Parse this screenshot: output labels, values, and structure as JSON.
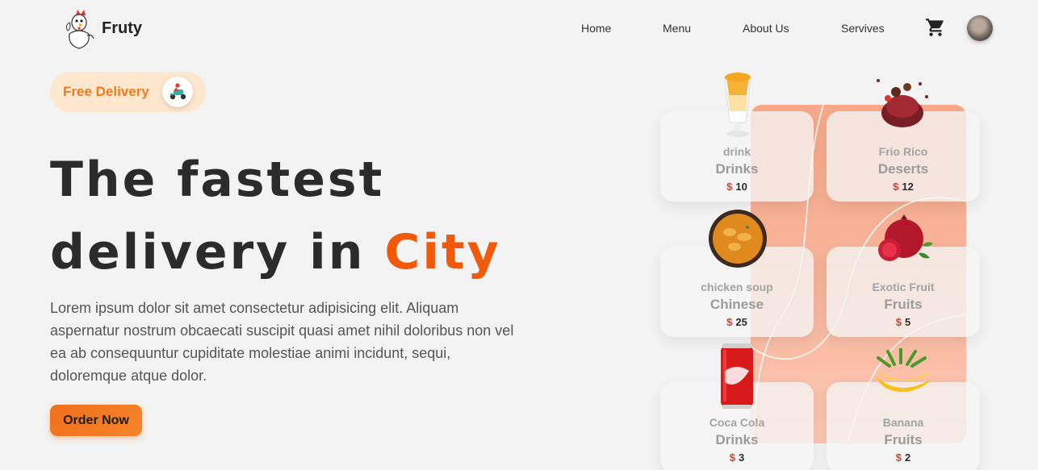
{
  "nav": {
    "logo": "Fruty",
    "links": [
      "Home",
      "Menu",
      "About Us",
      "Servives"
    ],
    "cart_icon": "cart-icon",
    "avatar": "user-avatar"
  },
  "hero": {
    "badge": "Free Delivery",
    "headline_line1": "The fastest",
    "headline_line2_prefix": "delivery in ",
    "headline_accent": "City",
    "description": "Lorem ipsum dolor sit amet consectetur adipisicing elit. Aliquam aspernatur nostrum obcaecati suscipit quasi amet nihil doloribus non vel ea ab consequuntur cupiditate molestiae animi incidunt, sequi, doloremque atque dolor.",
    "cta": "Order Now"
  },
  "colors": {
    "accent": "#f05a0a",
    "badge_bg": "#fde7cf",
    "price_currency": "#e23a2a"
  },
  "currency": "$",
  "cards": [
    {
      "name": "drink",
      "category": "Drinks",
      "price": "10",
      "image": "milkshake-image"
    },
    {
      "name": "Frio Rico",
      "category": "Deserts",
      "price": "12",
      "image": "dessert-image"
    },
    {
      "name": "chicken soup",
      "category": "Chinese",
      "price": "25",
      "image": "curry-image"
    },
    {
      "name": "Exotic Fruit",
      "category": "Fruits",
      "price": "5",
      "image": "pomegranate-image"
    },
    {
      "name": "Coca Cola",
      "category": "Drinks",
      "price": "3",
      "image": "cola-can-image"
    },
    {
      "name": "Banana",
      "category": "Fruits",
      "price": "2",
      "image": "banana-image"
    }
  ]
}
